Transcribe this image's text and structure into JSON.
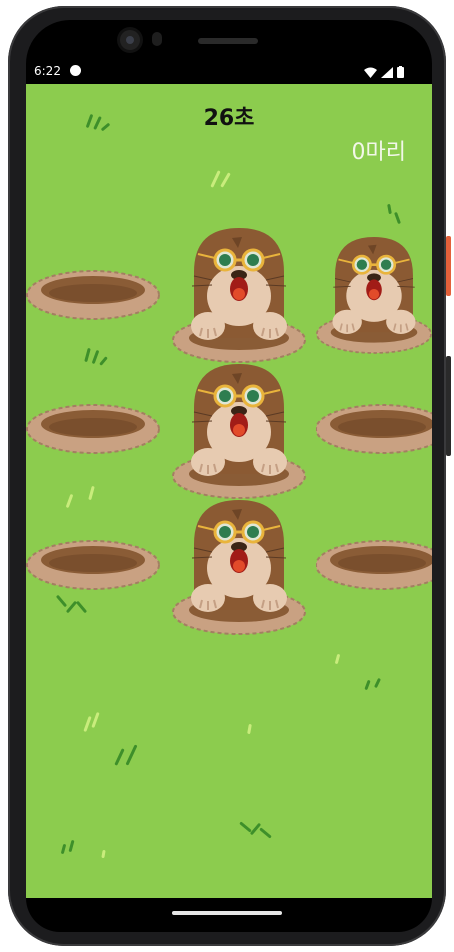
{
  "status_bar": {
    "time": "6:22",
    "icons": [
      "wifi-icon",
      "signal-icon",
      "battery-icon"
    ]
  },
  "game": {
    "timer_text": "26초",
    "score_text": "0마리",
    "colors": {
      "grass": "#8ccc4e",
      "hole_rim": "#c9a182",
      "hole_inner": "#8a5c36",
      "mole_fur": "#8b5a33",
      "mole_face": "#e7cbb1",
      "glasses": "#e9b43c"
    },
    "grid": [
      [
        "hole",
        "mole",
        "mole"
      ],
      [
        "hole",
        "mole",
        "hole"
      ],
      [
        "hole",
        "mole",
        "hole"
      ]
    ]
  }
}
